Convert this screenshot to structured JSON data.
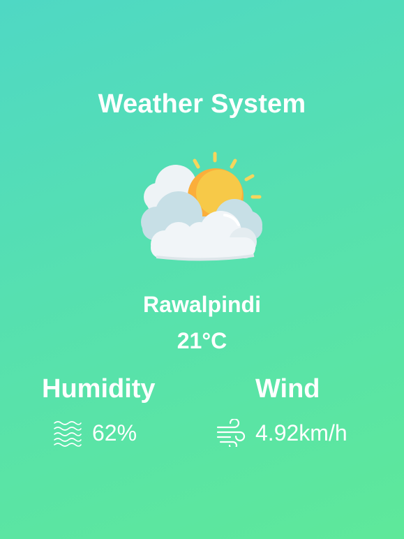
{
  "app": {
    "title": "Weather System"
  },
  "weather": {
    "icon": "sun-behind-clouds-icon",
    "city": "Rawalpindi",
    "temperature": "21°C"
  },
  "stats": {
    "humidity": {
      "label": "Humidity",
      "icon": "humidity-waves-icon",
      "value": "62%"
    },
    "wind": {
      "label": "Wind",
      "icon": "wind-icon",
      "value": "4.92km/h"
    }
  },
  "colors": {
    "background_start": "#4fd8c4",
    "background_end": "#5ee89a",
    "text": "#ffffff",
    "sun": "#f7c948",
    "sun_shade": "#fbae3b",
    "cloud_light": "#f0f4f7",
    "cloud_blue": "#c6dfe6"
  }
}
